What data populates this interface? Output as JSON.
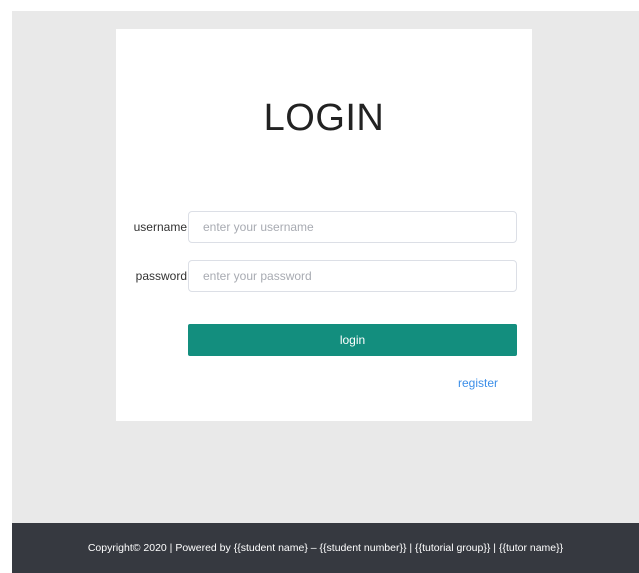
{
  "login": {
    "title": "LOGIN",
    "username": {
      "label": "username",
      "placeholder": "enter your username",
      "value": ""
    },
    "password": {
      "label": "password",
      "placeholder": "enter your password",
      "value": ""
    },
    "submit_label": "login",
    "register_label": "register"
  },
  "footer": {
    "text": "Copyright© 2020 | Powered by {{student name} – {{student number}} | {{tutorial group}} | {{tutor name}}"
  },
  "colors": {
    "background": "#e9e9e9",
    "card": "#ffffff",
    "primary_button": "#138e7e",
    "link": "#3b8ee8",
    "footer": "#363940"
  }
}
